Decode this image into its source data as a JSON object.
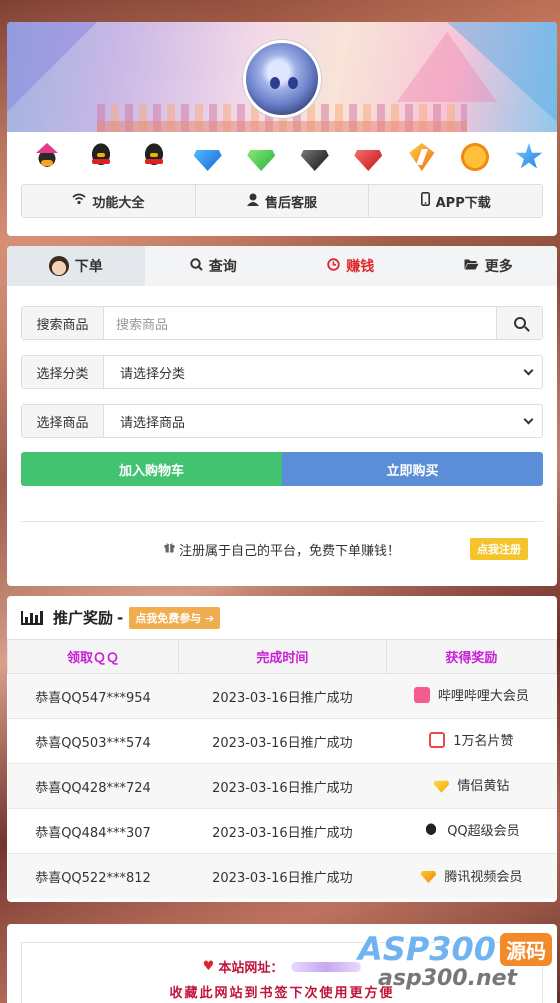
{
  "header": {
    "icons": [
      "qq-vip-icon",
      "qq-penguin-icon",
      "qq-penguin-red-icon",
      "blue-diamond-icon",
      "green-diamond-icon",
      "black-diamond-icon",
      "red-diamond-icon",
      "lightning-icon",
      "music-icon",
      "star-icon"
    ],
    "tabs": [
      {
        "icon": "wifi-icon",
        "label": "功能大全"
      },
      {
        "icon": "user-icon",
        "label": "售后客服"
      },
      {
        "icon": "mobile-icon",
        "label": "APP下载"
      }
    ]
  },
  "order": {
    "tabs": [
      {
        "label": "下单",
        "active": true
      },
      {
        "label": "查询"
      },
      {
        "label": "赚钱",
        "color": "#e0262a"
      },
      {
        "label": "更多"
      }
    ],
    "search_label": "搜索商品",
    "search_placeholder": "搜索商品",
    "category_label": "选择分类",
    "category_value": "请选择分类",
    "product_label": "选择商品",
    "product_value": "请选择商品",
    "cart_button": "加入购物车",
    "buy_button": "立即购买",
    "register_text": "注册属于自己的平台，免费下单赚钱！",
    "register_button": "点我注册"
  },
  "promo": {
    "title": "推广奖励",
    "separator": "-",
    "join_button": "点我免费参与 ➔",
    "columns": [
      "领取ＱＱ",
      "完成时间",
      "获得奖励"
    ],
    "rows": [
      {
        "qq": "恭喜QQ547***954",
        "time": "2023-03-16日推广成功",
        "reward": "哔哩哔哩大会员",
        "icon": "bilibili-icon"
      },
      {
        "qq": "恭喜QQ503***574",
        "time": "2023-03-16日推广成功",
        "reward": "1万名片赞",
        "icon": "like-icon"
      },
      {
        "qq": "恭喜QQ428***724",
        "time": "2023-03-16日推广成功",
        "reward": "情侣黄钻",
        "icon": "yellow-diamond-icon"
      },
      {
        "qq": "恭喜QQ484***307",
        "time": "2023-03-16日推广成功",
        "reward": "QQ超级会员",
        "icon": "qq-icon"
      },
      {
        "qq": "恭喜QQ522***812",
        "time": "2023-03-16日推广成功",
        "reward": "腾讯视频会员",
        "icon": "tencent-video-icon"
      }
    ]
  },
  "footer": {
    "site_label": "本站网址：",
    "bookmark_text": "收藏此网站到书签下次使用更方便"
  },
  "watermark": {
    "brand": "ASP300",
    "badge": "源码",
    "url": "asp300.net"
  },
  "colors": {
    "green": "#43c372",
    "blue": "#5b8ed6",
    "accent_red": "#e0262a",
    "table_header": "#c81ed8"
  }
}
